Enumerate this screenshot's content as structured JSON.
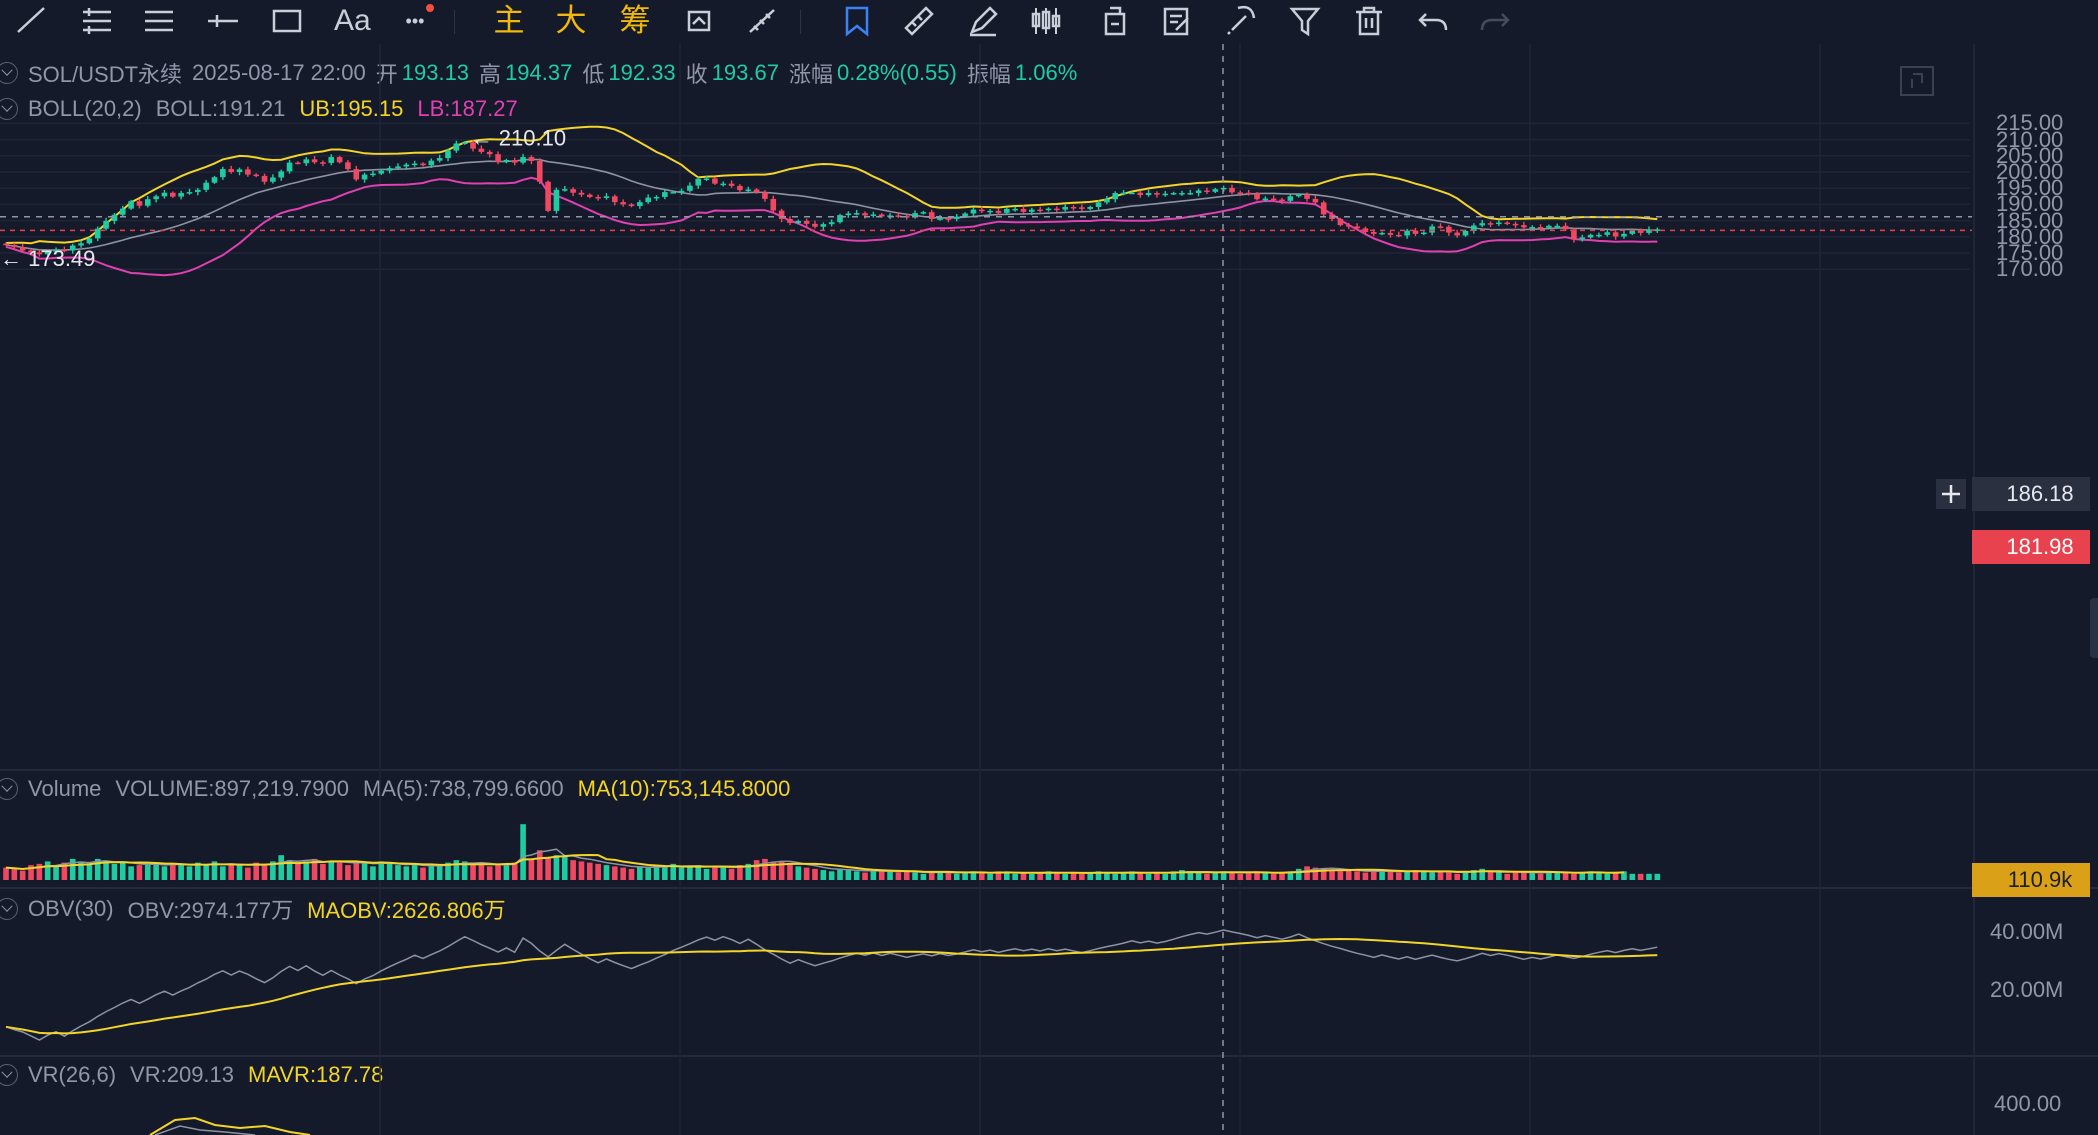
{
  "toolbar": {
    "items": [
      {
        "name": "line-tool-icon",
        "glyph": "line"
      },
      {
        "name": "horizontal-lines-icon",
        "glyph": "hlines"
      },
      {
        "name": "parallel-channel-icon",
        "glyph": "channel"
      },
      {
        "name": "crosshair-line-icon",
        "glyph": "cross"
      },
      {
        "name": "rectangle-icon",
        "glyph": "rect"
      },
      {
        "name": "text-tool-icon",
        "text": "Aa"
      },
      {
        "name": "more-icon",
        "text": "•••"
      },
      {
        "name": "main-chart-toggle",
        "text": "主"
      },
      {
        "name": "large-toggle",
        "text": "大"
      },
      {
        "name": "chip-distribution-toggle",
        "text": "筹"
      },
      {
        "name": "sync-icon",
        "glyph": "sync"
      },
      {
        "name": "measure-icon",
        "glyph": "measure"
      },
      {
        "name": "bookmark-icon",
        "glyph": "bookmark"
      },
      {
        "name": "ruler-icon",
        "glyph": "ruler"
      },
      {
        "name": "pen-icon",
        "glyph": "pen"
      },
      {
        "name": "candles-icon",
        "glyph": "candles"
      },
      {
        "name": "copy-icon",
        "glyph": "copy"
      },
      {
        "name": "edit-icon",
        "glyph": "edit"
      },
      {
        "name": "magnet-icon",
        "glyph": "magnet"
      },
      {
        "name": "filter-icon",
        "glyph": "filter"
      },
      {
        "name": "trash-icon",
        "glyph": "trash"
      },
      {
        "name": "undo-icon",
        "glyph": "undo"
      },
      {
        "name": "redo-icon",
        "glyph": "redo"
      }
    ]
  },
  "legend_main": {
    "symbol": "SOL/USDT永续",
    "datetime": "2025-08-17 22:00",
    "open_label": "开",
    "open": "193.13",
    "high_label": "高",
    "high": "194.37",
    "low_label": "低",
    "low": "192.33",
    "close_label": "收",
    "close": "193.67",
    "change_label": "涨幅",
    "change": "0.28%(0.55)",
    "amp_label": "振幅",
    "amp": "1.06%"
  },
  "legend_boll": {
    "name": "BOLL(20,2)",
    "boll": "BOLL:191.21",
    "ub": "UB:195.15",
    "lb": "LB:187.27"
  },
  "legend_volume": {
    "name": "Volume",
    "volume": "VOLUME:897,219.7900",
    "ma5": "MA(5):738,799.6600",
    "ma10": "MA(10):753,145.8000"
  },
  "legend_obv": {
    "name": "OBV(30)",
    "obv": "OBV:2974.177万",
    "maobv": "MAOBV:2626.806万"
  },
  "legend_vr": {
    "name": "VR(26,6)",
    "vr": "VR:209.13",
    "mavr": "MAVR:187.78"
  },
  "price_axis": [
    "215.00",
    "210.00",
    "205.00",
    "200.00",
    "195.00",
    "190.00",
    "185.00",
    "180.00",
    "175.00",
    "170.00"
  ],
  "obv_axis": [
    "40.00M",
    "20.00M"
  ],
  "vr_axis": [
    "400.00"
  ],
  "tags": {
    "crosshair_price": "186.18",
    "last_price": "181.98",
    "volume_last": "110.9k"
  },
  "annotations": {
    "high_mark": "210.10",
    "low_mark": "173.49"
  },
  "colors": {
    "up": "#1fcca2",
    "down": "#f04860",
    "ub": "#f3d428",
    "lb": "#e040b0",
    "mid": "#8d93a3",
    "last_price": "#e8424f",
    "volume_tag": "#d9a018",
    "background": "#151a2a"
  },
  "chart_data": {
    "type": "candlestick",
    "symbol": "SOL/USDT永续",
    "ylim": [
      165,
      218
    ],
    "close": [
      177.5,
      176.8,
      175.8,
      175.2,
      174.6,
      175.4,
      176.0,
      175.8,
      177.3,
      178.0,
      179.5,
      182.5,
      184.9,
      186.8,
      188.7,
      191.0,
      189.6,
      191.6,
      192.5,
      193.6,
      192.4,
      193.5,
      193.8,
      194.5,
      196.7,
      198.4,
      200.9,
      200.0,
      200.8,
      199.2,
      198.8,
      197.0,
      198.3,
      200.2,
      202.9,
      202.7,
      203.9,
      203.0,
      202.8,
      204.6,
      203.0,
      200.9,
      197.7,
      199.2,
      199.5,
      200.4,
      201.2,
      201.7,
      202.3,
      202.6,
      202.1,
      203.5,
      204.3,
      206.6,
      208.8,
      209.1,
      207.2,
      206.2,
      205.5,
      203.1,
      203.7,
      202.9,
      204.6,
      203.4,
      197.0,
      188.0,
      194.5,
      194.7,
      193.6,
      193.0,
      192.3,
      192.0,
      192.5,
      190.7,
      190.0,
      189.5,
      190.7,
      192.1,
      192.3,
      193.8,
      193.8,
      194.2,
      195.8,
      197.9,
      198.0,
      196.4,
      196.4,
      195.7,
      194.4,
      194.6,
      193.7,
      191.7,
      188.1,
      185.5,
      184.3,
      184.9,
      184.0,
      183.1,
      183.9,
      184.5,
      186.7,
      187.2,
      187.3,
      186.6,
      186.9,
      186.3,
      186.6,
      186.4,
      186.3,
      187.3,
      187.6,
      185.5,
      185.7,
      185.5,
      186.2,
      187.2,
      188.4,
      187.9,
      188.0,
      187.4,
      188.6,
      188.6,
      187.7,
      188.4,
      188.2,
      188.7,
      188.4,
      189.2,
      189.1,
      188.6,
      189.2,
      190.6,
      191.6,
      193.5,
      193.6,
      193.6,
      192.9,
      193.5,
      193.1,
      193.3,
      193.5,
      193.5,
      193.5,
      194.3,
      193.9,
      194.7,
      195.1,
      193.7,
      193.6,
      193.4,
      191.6,
      191.8,
      191.5,
      191.1,
      192.5,
      193.0,
      191.7,
      190.6,
      186.9,
      185.5,
      183.6,
      183.2,
      182.6,
      181.5,
      180.9,
      181.2,
      180.6,
      180.4,
      181.9,
      180.9,
      181.3,
      183.2,
      183.1,
      181.3,
      180.4,
      181.8,
      183.5,
      184.2,
      184.0,
      184.4,
      184.0,
      183.6,
      182.9,
      183.0,
      182.8,
      183.4,
      183.4,
      182.3,
      179.2,
      179.8,
      180.6,
      180.6,
      181.4,
      180.1,
      180.9,
      181.9,
      181.2,
      182.2,
      182.3
    ],
    "volume": [
      20,
      18,
      15,
      24,
      26,
      30,
      22,
      28,
      34,
      30,
      26,
      34,
      30,
      26,
      28,
      22,
      24,
      26,
      28,
      22,
      24,
      26,
      22,
      28,
      24,
      30,
      22,
      26,
      24,
      20,
      28,
      24,
      30,
      40,
      32,
      26,
      30,
      34,
      26,
      30,
      28,
      24,
      30,
      28,
      22,
      30,
      26,
      24,
      22,
      26,
      20,
      24,
      22,
      28,
      32,
      30,
      24,
      26,
      22,
      24,
      26,
      28,
      90,
      34,
      48,
      36,
      40,
      38,
      32,
      30,
      28,
      26,
      24,
      22,
      20,
      18,
      22,
      20,
      24,
      22,
      26,
      20,
      22,
      24,
      18,
      20,
      22,
      18,
      24,
      26,
      32,
      34,
      28,
      30,
      26,
      22,
      20,
      18,
      16,
      14,
      18,
      16,
      14,
      12,
      14,
      16,
      14,
      12,
      14,
      12,
      10,
      12,
      14,
      12,
      10,
      12,
      14,
      12,
      10,
      14,
      12,
      10,
      12,
      10,
      12,
      14,
      12,
      10,
      12,
      10,
      12,
      14,
      12,
      10,
      12,
      14,
      12,
      10,
      12,
      10,
      14,
      16,
      14,
      12,
      10,
      12,
      14,
      12,
      10,
      12,
      14,
      12,
      10,
      12,
      14,
      18,
      22,
      20,
      18,
      16,
      14,
      16,
      14,
      12,
      14,
      16,
      14,
      12,
      14,
      16,
      14,
      12,
      14,
      12,
      10,
      14,
      16,
      18,
      14,
      12,
      10,
      12,
      14,
      12,
      10,
      12,
      14,
      12,
      10,
      12,
      14,
      12,
      10,
      12,
      14
    ],
    "annotations": {
      "high": 210.1,
      "low": 173.49
    }
  }
}
